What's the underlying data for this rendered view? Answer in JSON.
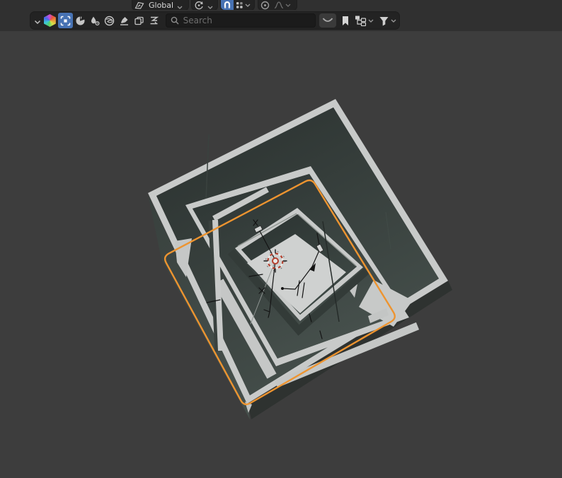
{
  "header": {
    "transform_orientation": {
      "label": "Global",
      "icon": "orientation-globe"
    },
    "pivot_point": {
      "icon": "pivot-rotate"
    },
    "snapping": {
      "magnet_enabled": true,
      "snap_to_icon": "snap-increment"
    },
    "proportional_editing": {
      "enabled": false,
      "toggle_icon": "proportional-circle",
      "falloff_icon": "falloff-curve"
    },
    "tool_row": {
      "collapse_icon": "chevron-down",
      "color_icon": "color-hexagon",
      "tools": [
        {
          "name": "select-box",
          "active": true
        },
        {
          "name": "pie-segment",
          "active": false
        },
        {
          "name": "droplet",
          "active": false
        },
        {
          "name": "swirl-globe",
          "active": false
        },
        {
          "name": "brush",
          "active": false
        },
        {
          "name": "pages",
          "active": false
        },
        {
          "name": "zigzag",
          "active": false
        }
      ],
      "search": {
        "placeholder": "Search",
        "icon": "magnifier"
      },
      "right_cluster": [
        {
          "name": "curve-arc"
        },
        {
          "name": "bookmark"
        },
        {
          "name": "hierarchy-tree",
          "has_dropdown": true
        },
        {
          "name": "filter-funnel",
          "has_dropdown": true
        }
      ]
    }
  },
  "viewport": {
    "description": "Top-down perspective view of nested square maze walls with light top edges and dark tall inner faces; selected floor plane shows orange outline; 3D cursor and black empty wireframes in the center room",
    "selected_object": "floor-plane",
    "cursor": "3d-cursor"
  },
  "colors": {
    "header_bg": "#303030",
    "pill_bg": "#232323",
    "accent_blue": "#4772b3",
    "viewport_bg": "#3d3d3d",
    "wall_top": "#c8cac9",
    "wall_dark": "#333b39",
    "floor_light": "#cfd1d0",
    "selection_orange": "#ed9430",
    "cursor_red": "#b5402e"
  }
}
